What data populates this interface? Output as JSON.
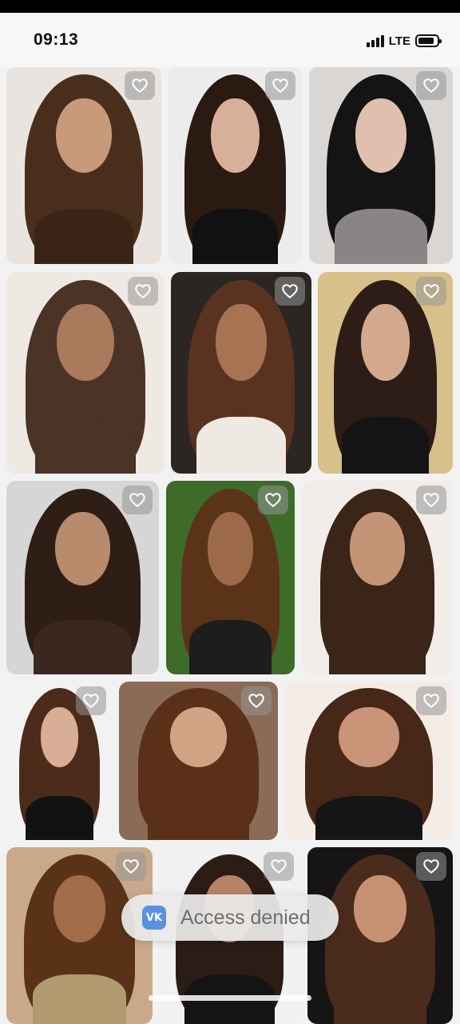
{
  "status_bar": {
    "time": "09:13",
    "network": "LTE",
    "signal_bars": 4,
    "battery_icon": "battery-icon"
  },
  "grid": {
    "favorite_icon": "heart-outline-icon",
    "tiles": [
      {
        "bg": "#e9e4df",
        "hair": "#4a2e1c",
        "skin": "#c79a7a",
        "top": "#3a2418"
      },
      {
        "bg": "#ececec",
        "hair": "#2a1a12",
        "skin": "#d8b09a",
        "top": "#111111"
      },
      {
        "bg": "#d9d6d4",
        "hair": "#141414",
        "skin": "#e0bfae",
        "top": "#8b8485"
      },
      {
        "bg": "#efe9e3",
        "hair": "#4b3325",
        "skin": "#a97a5c",
        "top": "#4b3325"
      },
      {
        "bg": "#2b2622",
        "hair": "#5a3320",
        "skin": "#a77353",
        "top": "#eeeae3"
      },
      {
        "bg": "#d8c08a",
        "hair": "#2d1d16",
        "skin": "#d3a98d",
        "top": "#141414"
      },
      {
        "bg": "#d6d6d6",
        "hair": "#2e1e16",
        "skin": "#b88b6c",
        "top": "#3a2820"
      },
      {
        "bg": "#3e6a2a",
        "hair": "#5b3318",
        "skin": "#9c6a4a",
        "top": "#1d1d1d"
      },
      {
        "bg": "#f2ede8",
        "hair": "#3b2418",
        "skin": "#c59476",
        "top": "#3b2418"
      },
      {
        "bg": "#f2f2f2",
        "hair": "#4d2b1a",
        "skin": "#d8ae96",
        "top": "#121212"
      },
      {
        "bg": "#8b6a56",
        "hair": "#5a3018",
        "skin": "#d0a385",
        "top": "#5a3018"
      },
      {
        "bg": "#f4ece6",
        "hair": "#472818",
        "skin": "#c99477",
        "top": "#151515"
      },
      {
        "bg": "#c9a98a",
        "hair": "#5a3218",
        "skin": "#a36c48",
        "top": "#b29a70"
      },
      {
        "bg": "#f1f1f1",
        "hair": "#2b1c15",
        "skin": "#b78266",
        "top": "#141414"
      },
      {
        "bg": "#171414",
        "hair": "#4a2b1c",
        "skin": "#c69273",
        "top": "#4a2b1c"
      }
    ]
  },
  "toast": {
    "icon": "vk-logo-icon",
    "logo_text": "VK",
    "message": "Access denied"
  }
}
